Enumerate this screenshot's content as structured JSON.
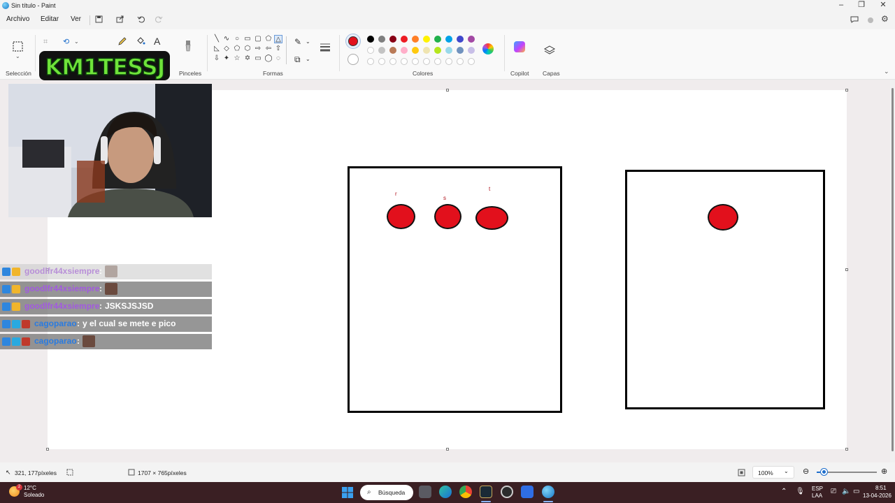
{
  "window": {
    "title": "Sin título - Paint",
    "minimize": "–",
    "maximize": "❐",
    "close": "✕"
  },
  "menu": {
    "items": [
      "Archivo",
      "Editar",
      "Ver"
    ]
  },
  "ribbon": {
    "groups": {
      "seleccion": "Selección",
      "pinceles": "Pinceles",
      "formas": "Formas",
      "colores": "Colores",
      "copilot": "Copilot",
      "capas": "Capas"
    },
    "primary_color": "#e2101c",
    "palette_row1": [
      "#000000",
      "#7f7f7f",
      "#880015",
      "#ed1c24",
      "#ff7f27",
      "#fff200",
      "#22b14c",
      "#00a2e8",
      "#3f48cc",
      "#a349a4"
    ],
    "palette_row2": [
      "#ffffff",
      "#c3c3c3",
      "#b97a57",
      "#ffaec9",
      "#ffc90e",
      "#efe4b0",
      "#b5e61d",
      "#99d9ea",
      "#7092be",
      "#c8bfe7"
    ]
  },
  "overlay": {
    "logo_text": "KM1TESSJ"
  },
  "canvas": {
    "labels": {
      "r": "r",
      "s": "s",
      "t": "t"
    }
  },
  "chat": {
    "rows": [
      {
        "user": "goodlfr44xsiempre",
        "sep": " :",
        "msg": "",
        "emote": true,
        "faded": true,
        "user_color": "#b88fd8"
      },
      {
        "user": "goodlfr44xsiempre",
        "sep": " :",
        "msg": "",
        "emote": true,
        "faded": false,
        "user_color": "#a259e0"
      },
      {
        "user": "goodlfr44xsiempre",
        "sep": " :",
        "msg": "JSKSJSJSD",
        "emote": false,
        "faded": false,
        "user_color": "#a259e0"
      },
      {
        "user": "cagoparao",
        "sep": " :",
        "msg": "y el cual se mete e pico",
        "emote": false,
        "faded": false,
        "user_color": "#2a7be0"
      },
      {
        "user": "cagoparao",
        "sep": " :",
        "msg": "",
        "emote": true,
        "faded": false,
        "user_color": "#2a7be0"
      }
    ]
  },
  "status": {
    "cursor_pos": "321, 177píxeles",
    "canvas_size": "1707 × 765píxeles",
    "zoom_label": "100%",
    "zoom_fraction": 0.12
  },
  "taskbar": {
    "weather_temp": "12°C",
    "weather_desc": "Soleado",
    "weather_badge": "2",
    "search_label": "Búsqueda",
    "lang": "ESP",
    "lang_sub": "LAA",
    "time": "8:51",
    "date": "13-04-2026"
  }
}
